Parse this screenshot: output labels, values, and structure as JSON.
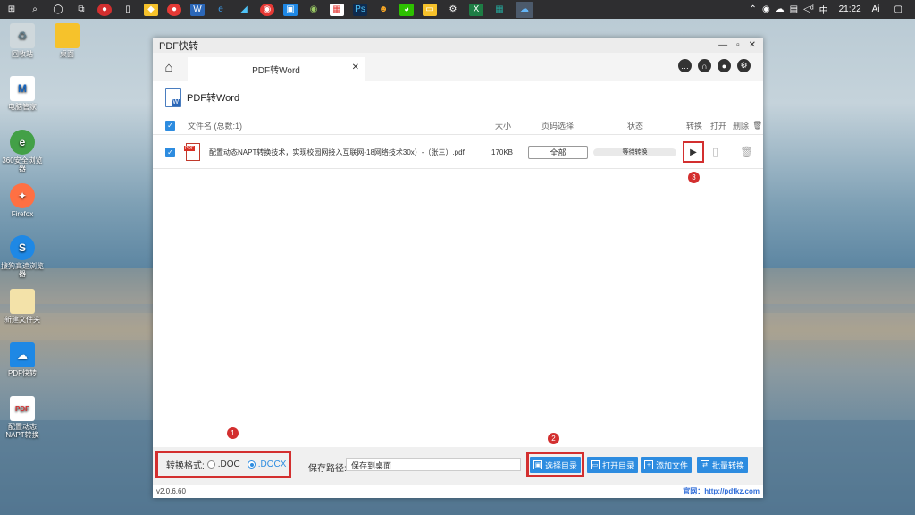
{
  "taskbar": {
    "clock": "21:22",
    "ime": "中",
    "volume": "ᵈ",
    "ai_label": "Ai"
  },
  "desktop_icons": [
    {
      "label": "回收站",
      "icon": "recycle-bin-icon"
    },
    {
      "label": "电脑管家",
      "icon": "pc-manager-icon"
    },
    {
      "label": "360安全浏览器",
      "icon": "360-browser-icon"
    },
    {
      "label": "Firefox",
      "icon": "firefox-icon"
    },
    {
      "label": "搜狗高速浏览器",
      "icon": "sogou-browser-icon"
    },
    {
      "label": "新建文件夹",
      "icon": "folder-icon"
    },
    {
      "label": "PDF快转",
      "icon": "pdf-kuaizhuan-icon"
    },
    {
      "label": "配置动态NAPT转换",
      "icon": "pdf-file-icon"
    },
    {
      "label": "桌面",
      "icon": "folder-icon"
    }
  ],
  "window": {
    "title": "PDF快转",
    "tab_label": "PDF转Word",
    "section_title": "PDF转Word",
    "columns": {
      "filename": "文件名 (总数:1)",
      "size": "大小",
      "pages": "页码选择",
      "status": "状态",
      "convert": "转换",
      "open": "打开",
      "delete": "删除"
    },
    "file": {
      "name": "配置动态NAPT转换技术，实现校园网接入互联网-18网络技术30x）-（张三）.pdf",
      "size": "170KB",
      "pages": "全部",
      "status": "等待转换"
    },
    "badges": [
      "1",
      "2",
      "3"
    ],
    "format_label": "转换格式:",
    "format_options": [
      ".DOC",
      ".DOCX"
    ],
    "selected_format": ".DOCX",
    "save_label": "保存路径:",
    "save_value": "保存到桌面",
    "buttons": {
      "choose_dir": "选择目录",
      "open_dir": "打开目录",
      "add_file": "添加文件",
      "batch_convert": "批量转换"
    },
    "version": "v2.0.6.60",
    "website": "官网：http://pdfkz.com"
  }
}
